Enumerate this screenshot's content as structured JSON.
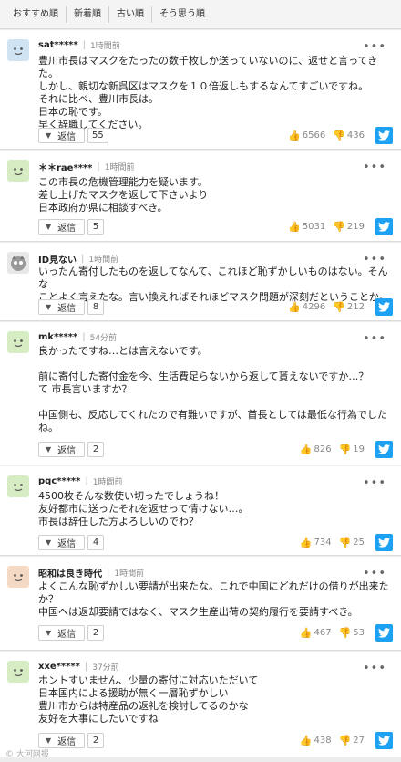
{
  "tabs": [
    "おすすめ順",
    "新着順",
    "古い順",
    "そう思う順"
  ],
  "ui": {
    "reply_label": "返信",
    "more_label": "•••",
    "watermark": "© 大河网报"
  },
  "comments": [
    {
      "user": "sat*****",
      "time": "1時間前",
      "lines": [
        "豊川市長はマスクをたったの数千枚しか送っていないのに、返せと言ってきた。",
        "しかし、親切な新呉区はマスクを１０倍返しもするなんてすごいですね。",
        "それに比べ、豊川市長は。",
        "日本の恥です。",
        "早く辞職してください。"
      ],
      "replies": "55",
      "likes": "6566",
      "dislikes": "436",
      "avatar": "#cfe3f3"
    },
    {
      "user": "＊＊rae****",
      "time": "1時間前",
      "lines": [
        "この市長の危機管理能力を疑います。",
        "差し上げたマスクを返して下さいより",
        "日本政府か県に相談すべき。"
      ],
      "replies": "5",
      "likes": "5031",
      "dislikes": "219",
      "avatar": "#d6ecc2"
    },
    {
      "user": "ID見ない",
      "time": "1時間前",
      "lines": [
        "いったん寄付したものを返してなんて、これほど恥ずかしいものはない。そんな",
        "ことよく言えたな。言い換えればそれほどマスク問題が深刻だということか。"
      ],
      "replies": "8",
      "likes": "4296",
      "dislikes": "212",
      "avatar": "#e8e8e8"
    },
    {
      "user": "mk*****",
      "time": "54分前",
      "lines": [
        "良かったですね…とは言えないです。",
        "",
        "前に寄付した寄付金を今、生活費足らないから返して貰えないですか…？",
        "て 市長言いますか？",
        "",
        "中国側も、反応してくれたので有難いですが、首長としては最低な行為でした",
        "ね。"
      ],
      "replies": "2",
      "likes": "826",
      "dislikes": "19",
      "avatar": "#d6ecc2"
    },
    {
      "user": "pqc*****",
      "time": "1時間前",
      "lines": [
        "4500枚そんな数使い切ったでしょうね！",
        "友好都市に送ったそれを返せって情けない…。",
        "市長は辞任した方よろしいのでわ？"
      ],
      "replies": "4",
      "likes": "734",
      "dislikes": "25",
      "avatar": "#d6ecc2"
    },
    {
      "user": "昭和は良き時代",
      "time": "1時間前",
      "lines": [
        "よくこんな恥ずかしい要請が出来たな。これで中国にどれだけの借りが出来た",
        "か？",
        "中国へは返却要請ではなく、マスク生産出荷の契約履行を要請すべき。"
      ],
      "replies": "2",
      "likes": "467",
      "dislikes": "53",
      "avatar": "#f4d9c4"
    },
    {
      "user": "xxe*****",
      "time": "37分前",
      "lines": [
        "ホントすいません、少量の寄付に対応いただいて",
        "日本国内による援助が無く一層恥ずかしい",
        "豊川市からは特産品の返礼を検討してるのかな",
        "友好を大事にしたいですね"
      ],
      "replies": "2",
      "likes": "438",
      "dislikes": "27",
      "avatar": "#d6ecc2"
    }
  ]
}
